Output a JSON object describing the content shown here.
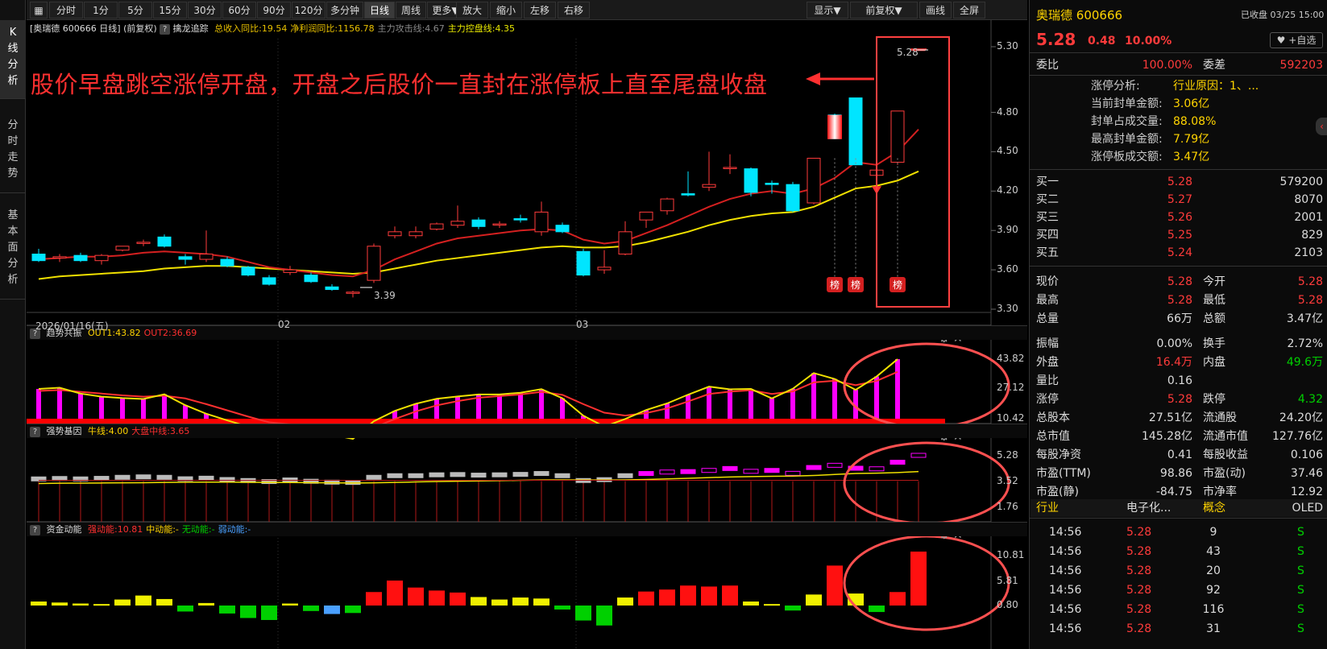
{
  "left_tabs": [
    "K线分析",
    "分时走势",
    "基本面分析"
  ],
  "toolbar": {
    "periods": [
      "分时",
      "1分",
      "5分",
      "15分",
      "30分",
      "60分",
      "90分",
      "120分",
      "多分钟",
      "日线",
      "周线",
      "更多▼"
    ],
    "active": "日线",
    "actions": [
      "放大",
      "缩小",
      "左移",
      "右移"
    ],
    "right": [
      "显示▼",
      "前复权▼",
      "画线",
      "全屏"
    ]
  },
  "info": {
    "stock": "[奥瑞德 600666 日线]",
    "adj": "(前复权)",
    "indicator": "擒龙追踪",
    "items": [
      {
        "text": "总收入同比:19.54",
        "color": "#e8c000"
      },
      {
        "text": "净利润同比:1156.78",
        "color": "#e8c000"
      },
      {
        "text": "主力攻击线:4.67",
        "color": "#888"
      },
      {
        "text": "主力控盘线:4.35",
        "color": "#e8e800"
      }
    ]
  },
  "annotation": "股价早盘跳空涨停开盘，开盘之后股价一直封在涨停板上直至尾盘收盘",
  "main_axis": {
    "labels": [
      "5.30",
      "4.80",
      "4.50",
      "4.20",
      "3.90",
      "3.60",
      "3.30"
    ],
    "min": 3.3,
    "max": 5.3
  },
  "date_labels": [
    "2026/01/16(五)",
    "02",
    "03"
  ],
  "low_label": "3.39",
  "high_label": "5.28",
  "bang": "榜",
  "panels": [
    {
      "title": "趋势共振",
      "items": [
        {
          "text": "OUT1:43.82",
          "color": "#ffd400"
        },
        {
          "text": "OUT2:36.69",
          "color": "#ff3030"
        }
      ],
      "axis": [
        "43.82",
        "27.12",
        "10.42"
      ]
    },
    {
      "title": "强势基因",
      "items": [
        {
          "text": "牛线:4.00",
          "color": "#ffd400"
        },
        {
          "text": "大盘中线:3.65",
          "color": "#ff3030"
        }
      ],
      "axis": [
        "5.28",
        "3.52",
        "1.76"
      ]
    },
    {
      "title": "资金动能",
      "items": [
        {
          "text": "强动能:10.81",
          "color": "#ff3030"
        },
        {
          "text": "中动能:-",
          "color": "#ffd400"
        },
        {
          "text": "无动能:-",
          "color": "#00d000"
        },
        {
          "text": "弱动能:-",
          "color": "#4aa0ff"
        }
      ],
      "axis": [
        "10.81",
        "5.81",
        "0.80"
      ]
    }
  ],
  "chart_data": {
    "type": "candlestick",
    "candles": [
      [
        3.72,
        3.76,
        3.67,
        3.66
      ],
      [
        3.69,
        3.72,
        3.7,
        3.66
      ],
      [
        3.71,
        3.73,
        3.67,
        3.66
      ],
      [
        3.67,
        3.72,
        3.71,
        3.64
      ],
      [
        3.75,
        3.77,
        3.78,
        3.74
      ],
      [
        3.81,
        3.83,
        3.81,
        3.78
      ],
      [
        3.85,
        3.87,
        3.78,
        3.77
      ],
      [
        3.7,
        3.72,
        3.68,
        3.64
      ],
      [
        3.68,
        3.9,
        3.72,
        3.66
      ],
      [
        3.68,
        3.7,
        3.63,
        3.62
      ],
      [
        3.62,
        3.63,
        3.56,
        3.55
      ],
      [
        3.54,
        3.56,
        3.49,
        3.48
      ],
      [
        3.58,
        3.63,
        3.6,
        3.56
      ],
      [
        3.56,
        3.58,
        3.51,
        3.5
      ],
      [
        3.47,
        3.49,
        3.45,
        3.44
      ],
      [
        3.43,
        3.44,
        3.43,
        3.39
      ],
      [
        3.52,
        3.8,
        3.78,
        3.5
      ],
      [
        3.86,
        3.93,
        3.89,
        3.84
      ],
      [
        3.86,
        3.93,
        3.89,
        3.84
      ],
      [
        3.91,
        3.96,
        3.95,
        3.9
      ],
      [
        3.94,
        4.09,
        3.97,
        3.92
      ],
      [
        3.98,
        4.0,
        3.93,
        3.91
      ],
      [
        3.95,
        3.97,
        3.95,
        3.92
      ],
      [
        3.99,
        4.02,
        3.98,
        3.96
      ],
      [
        3.89,
        4.12,
        4.04,
        3.86
      ],
      [
        3.94,
        3.96,
        3.89,
        3.88
      ],
      [
        3.74,
        3.76,
        3.56,
        3.55
      ],
      [
        3.6,
        3.75,
        3.62,
        3.57
      ],
      [
        3.72,
        3.97,
        3.89,
        3.71
      ],
      [
        3.98,
        4.04,
        4.04,
        3.92
      ],
      [
        4.05,
        4.15,
        4.14,
        4.02
      ],
      [
        4.18,
        4.35,
        4.17,
        4.16
      ],
      [
        4.23,
        4.5,
        4.25,
        4.2
      ],
      [
        4.38,
        4.48,
        4.38,
        4.33
      ],
      [
        4.37,
        4.38,
        4.19,
        4.16
      ],
      [
        4.26,
        4.28,
        4.25,
        4.18
      ],
      [
        4.25,
        4.27,
        4.05,
        4.04
      ],
      [
        4.11,
        4.45,
        4.45,
        4.1
      ],
      [
        4.78,
        4.79,
        4.6,
        4.6
      ],
      [
        4.91,
        4.91,
        4.4,
        4.4
      ],
      [
        4.32,
        4.59,
        4.36,
        4.23
      ],
      [
        4.42,
        4.81,
        4.81,
        4.4
      ],
      [
        5.28,
        5.28,
        5.28,
        5.28
      ]
    ],
    "ma_fast": [
      3.68,
      3.69,
      3.7,
      3.7,
      3.71,
      3.73,
      3.74,
      3.73,
      3.72,
      3.7,
      3.66,
      3.62,
      3.6,
      3.58,
      3.56,
      3.55,
      3.6,
      3.68,
      3.74,
      3.8,
      3.84,
      3.86,
      3.88,
      3.9,
      3.91,
      3.9,
      3.83,
      3.8,
      3.82,
      3.88,
      3.94,
      4.01,
      4.08,
      4.14,
      4.18,
      4.2,
      4.18,
      4.22,
      4.3,
      4.42,
      4.4,
      4.5,
      4.67
    ],
    "ma_slow": [
      3.53,
      3.55,
      3.56,
      3.57,
      3.58,
      3.59,
      3.61,
      3.62,
      3.63,
      3.63,
      3.62,
      3.61,
      3.6,
      3.59,
      3.58,
      3.57,
      3.58,
      3.61,
      3.64,
      3.67,
      3.69,
      3.71,
      3.73,
      3.75,
      3.77,
      3.78,
      3.77,
      3.77,
      3.78,
      3.81,
      3.85,
      3.89,
      3.94,
      3.98,
      4.01,
      4.03,
      4.04,
      4.08,
      4.15,
      4.22,
      4.24,
      4.28,
      4.35
    ],
    "osc1": [
      27.1,
      27.8,
      24.5,
      22.8,
      22.0,
      21.5,
      24.1,
      18.0,
      13.2,
      9.5,
      6.0,
      4.0,
      5.5,
      3.8,
      1.5,
      -0.9,
      9.0,
      14.8,
      18.8,
      21.6,
      22.9,
      24.0,
      24.0,
      25.0,
      27.0,
      21.9,
      12.1,
      6.0,
      10.3,
      15.3,
      19.0,
      23.9,
      28.4,
      26.9,
      27.1,
      21.8,
      27.2,
      36.0,
      32.7,
      26.6,
      34.1,
      43.8
    ],
    "osc2": [
      26.0,
      26.5,
      25.5,
      24.5,
      23.5,
      22.8,
      23.3,
      21.8,
      18.6,
      15.1,
      11.6,
      8.4,
      7.3,
      6.0,
      4.4,
      2.2,
      5.5,
      10.2,
      14.5,
      17.9,
      20.3,
      22.2,
      23.1,
      24.0,
      25.5,
      23.8,
      18.6,
      13.8,
      12.2,
      13.6,
      16.2,
      20.1,
      24.3,
      25.6,
      26.4,
      24.3,
      25.7,
      30.8,
      31.7,
      29.2,
      31.6,
      36.7
    ],
    "cap": [
      0.8,
      0.6,
      0.4,
      0.3,
      1.2,
      2.0,
      1.3,
      -1.2,
      0.5,
      -1.6,
      -2.5,
      -2.9,
      0.4,
      -1.1,
      -1.7,
      -1.5,
      2.7,
      5.0,
      3.6,
      3.0,
      2.6,
      1.7,
      1.2,
      1.6,
      1.4,
      -0.8,
      -3.0,
      -4.0,
      1.6,
      2.8,
      3.2,
      4.0,
      3.8,
      4.0,
      0.8,
      0.3,
      -1.0,
      2.2,
      8.0,
      2.4,
      -1.3,
      2.7,
      10.8
    ]
  },
  "quote": {
    "name": "奥瑞德",
    "code": "600666",
    "status": "已收盘",
    "date": "03/25",
    "tz": "15:00",
    "price": "5.28",
    "change": "0.48",
    "pct": "10.00%",
    "fav": "+自选",
    "weibi_label": "委比",
    "weibi": "100.00%",
    "weicha_label": "委差",
    "weicha": "592203",
    "limit_info": [
      {
        "label": "涨停分析:",
        "value": "行业原因：1、..."
      },
      {
        "label": "当前封单金额:",
        "value": "3.06亿"
      },
      {
        "label": "封单占成交量:",
        "value": "88.08%"
      },
      {
        "label": "最高封单金额:",
        "value": "7.79亿"
      },
      {
        "label": "涨停板成交额:",
        "value": "3.47亿"
      }
    ],
    "bids": [
      {
        "label": "买一",
        "price": "5.28",
        "vol": "579200"
      },
      {
        "label": "买二",
        "price": "5.27",
        "vol": "8070"
      },
      {
        "label": "买三",
        "price": "5.26",
        "vol": "2001"
      },
      {
        "label": "买四",
        "price": "5.25",
        "vol": "829"
      },
      {
        "label": "买五",
        "price": "5.24",
        "vol": "2103"
      }
    ],
    "stats": [
      {
        "l1": "现价",
        "v1": "5.28",
        "c1": "red",
        "l2": "今开",
        "v2": "5.28",
        "c2": "red"
      },
      {
        "l1": "最高",
        "v1": "5.28",
        "c1": "red",
        "l2": "最低",
        "v2": "5.28",
        "c2": "red"
      },
      {
        "l1": "总量",
        "v1": "66万",
        "c1": "white",
        "l2": "总额",
        "v2": "3.47亿",
        "c2": "white"
      },
      {
        "l1": "振幅",
        "v1": "0.00%",
        "c1": "white",
        "l2": "换手",
        "v2": "2.72%",
        "c2": "white"
      },
      {
        "l1": "外盘",
        "v1": "16.4万",
        "c1": "red",
        "l2": "内盘",
        "v2": "49.6万",
        "c2": "green"
      },
      {
        "l1": "量比",
        "v1": "0.16",
        "c1": "white",
        "l2": "",
        "v2": "",
        "c2": "white"
      },
      {
        "l1": "涨停",
        "v1": "5.28",
        "c1": "red",
        "l2": "跌停",
        "v2": "4.32",
        "c2": "green"
      },
      {
        "l1": "总股本",
        "v1": "27.51亿",
        "c1": "white",
        "l2": "流通股",
        "v2": "24.20亿",
        "c2": "white"
      },
      {
        "l1": "总市值",
        "v1": "145.28亿",
        "c1": "white",
        "l2": "流通市值",
        "v2": "127.76亿",
        "c2": "white"
      },
      {
        "l1": "每股净资",
        "v1": "0.41",
        "c1": "white",
        "l2": "每股收益",
        "v2": "0.106",
        "c2": "white"
      },
      {
        "l1": "市盈(TTM)",
        "v1": "98.86",
        "c1": "white",
        "l2": "市盈(动)",
        "v2": "37.46",
        "c2": "white"
      },
      {
        "l1": "市盈(静)",
        "v1": "-84.75",
        "c1": "white",
        "l2": "市净率",
        "v2": "12.92",
        "c2": "white"
      }
    ],
    "industry_label": "行业",
    "industry": "电子化...",
    "concept_label": "概念",
    "concept": "OLED",
    "ticks": [
      {
        "time": "14:56",
        "price": "5.28",
        "vol": "9",
        "side": "S"
      },
      {
        "time": "14:56",
        "price": "5.28",
        "vol": "43",
        "side": "S"
      },
      {
        "time": "14:56",
        "price": "5.28",
        "vol": "20",
        "side": "S"
      },
      {
        "time": "14:56",
        "price": "5.28",
        "vol": "92",
        "side": "S"
      },
      {
        "time": "14:56",
        "price": "5.28",
        "vol": "116",
        "side": "S"
      },
      {
        "time": "14:56",
        "price": "5.28",
        "vol": "31",
        "side": "S"
      }
    ]
  }
}
